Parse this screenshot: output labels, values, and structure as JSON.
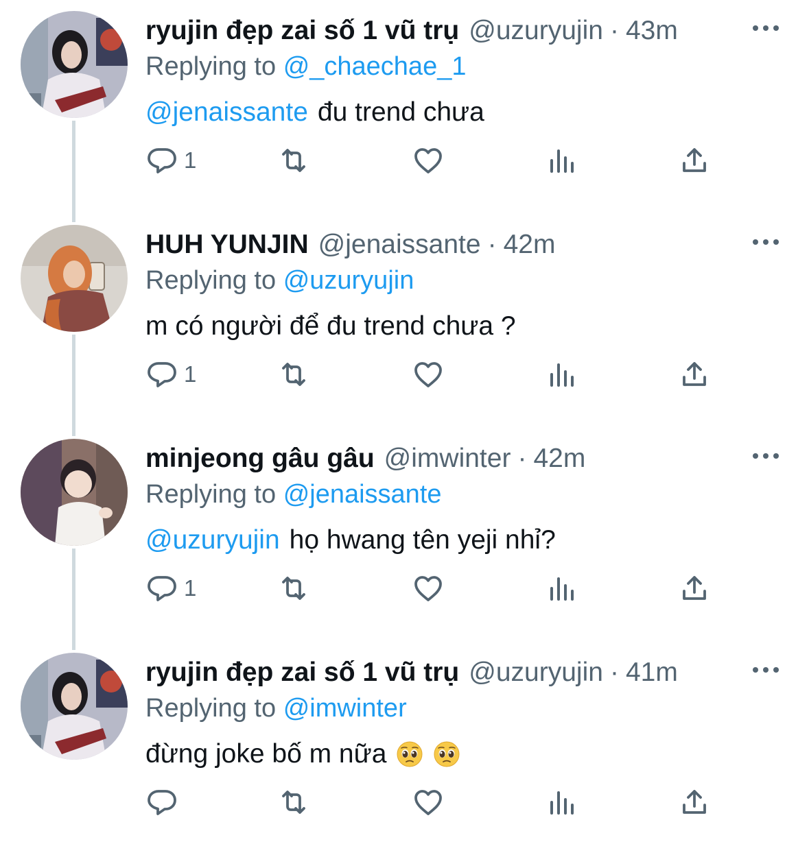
{
  "colors": {
    "text": "#0f1419",
    "secondary": "#536471",
    "link": "#1d9bf0",
    "thread_line": "#cfd9de"
  },
  "icons": {
    "reply": "reply-icon",
    "retweet": "retweet-icon",
    "like": "heart-icon",
    "views": "analytics-icon",
    "share": "share-icon",
    "more": "more-icon"
  },
  "tweets": [
    {
      "name": "ryujin đẹp zai số 1 vũ trụ",
      "handle": "@uzuryujin",
      "separator": "·",
      "time": "43m",
      "replying_label": "Replying to",
      "replying_to": "@_chaechae_1",
      "mention": "@jenaissante",
      "text": "đu trend chưa",
      "reply_count": "1",
      "avatar": "ryujin-avatar"
    },
    {
      "name": "HUH YUNJIN",
      "handle": "@jenaissante",
      "separator": "·",
      "time": "42m",
      "replying_label": "Replying to",
      "replying_to": "@uzuryujin",
      "mention": "",
      "text": "m có người để đu trend chưa ?",
      "reply_count": "1",
      "avatar": "yunjin-avatar"
    },
    {
      "name": "minjeong gâu gâu",
      "handle": "@imwinter",
      "separator": "·",
      "time": "42m",
      "replying_label": "Replying to",
      "replying_to": "@jenaissante",
      "mention": "@uzuryujin",
      "text": "họ hwang tên yeji nhỉ?",
      "reply_count": "1",
      "avatar": "minjeong-avatar"
    },
    {
      "name": "ryujin đẹp zai số 1 vũ trụ",
      "handle": "@uzuryujin",
      "separator": "·",
      "time": "41m",
      "replying_label": "Replying to",
      "replying_to": "@imwinter",
      "mention": "",
      "text": "đừng joke bố m nữa",
      "emojis": [
        "pleading-face-emoji",
        "pleading-face-emoji"
      ],
      "reply_count": "",
      "avatar": "ryujin-avatar"
    }
  ]
}
